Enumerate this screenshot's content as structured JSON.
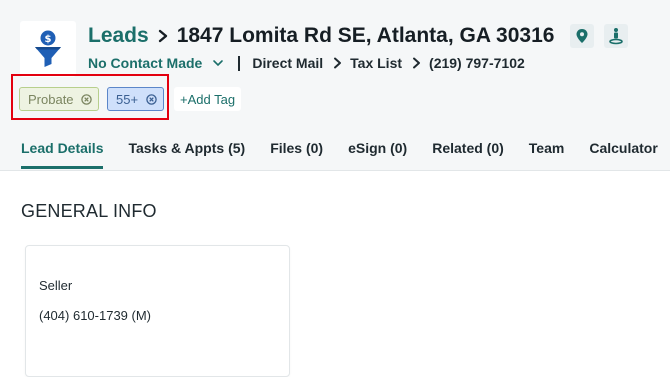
{
  "header": {
    "breadcrumb_root": "Leads",
    "address": "1847 Lomita Rd SE, Atlanta, GA 30316",
    "status": "No Contact Made",
    "source": "Direct Mail",
    "list": "Tax List",
    "phone": "(219) 797-7102"
  },
  "tags": {
    "items": [
      {
        "label": "Probate",
        "color": "#eef3e2"
      },
      {
        "label": "55+",
        "color": "#cfe0fb"
      }
    ],
    "add_label": "+Add Tag"
  },
  "tabs": [
    {
      "label": "Lead Details",
      "active": true
    },
    {
      "label": "Tasks & Appts (5)",
      "active": false
    },
    {
      "label": "Files (0)",
      "active": false
    },
    {
      "label": "eSign (0)",
      "active": false
    },
    {
      "label": "Related (0)",
      "active": false
    },
    {
      "label": "Team",
      "active": false
    },
    {
      "label": "Calculator",
      "active": false
    }
  ],
  "general_info": {
    "title": "GENERAL INFO",
    "seller_label": "Seller",
    "seller_phone": "(404) 610-1739  (M)"
  },
  "colors": {
    "accent": "#1b6f6a",
    "highlight_box": "#e3000f",
    "logo_blue": "#1f5fb5"
  },
  "icons": [
    "funnel-dollar-logo-icon",
    "map-pin-icon",
    "street-view-icon",
    "chevron-right-icon",
    "chevron-down-icon",
    "tag-remove-icon"
  ]
}
